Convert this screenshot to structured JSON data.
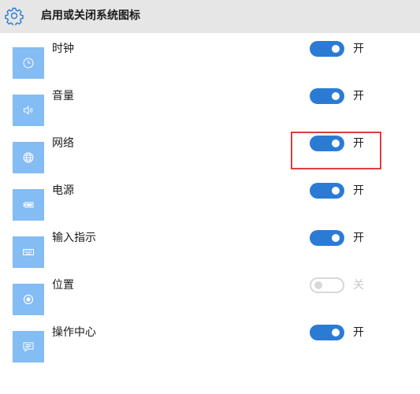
{
  "header": {
    "title": "启用或关闭系统图标",
    "icon": "gear-icon"
  },
  "items": [
    {
      "label": "时钟",
      "state": "开",
      "on": true,
      "icon": "clock-icon"
    },
    {
      "label": "音量",
      "state": "开",
      "on": true,
      "icon": "volume-icon"
    },
    {
      "label": "网络",
      "state": "开",
      "on": true,
      "icon": "globe-icon"
    },
    {
      "label": "电源",
      "state": "开",
      "on": true,
      "icon": "battery-icon"
    },
    {
      "label": "输入指示",
      "state": "开",
      "on": true,
      "icon": "keyboard-icon"
    },
    {
      "label": "位置",
      "state": "关",
      "on": false,
      "icon": "location-icon"
    },
    {
      "label": "操作中心",
      "state": "开",
      "on": true,
      "icon": "message-icon"
    }
  ],
  "colors": {
    "header_bg": "#e6e6e6",
    "tile_bg": "#84bcf4",
    "toggle_on": "#2b7bd4",
    "toggle_off_border": "#d8d8d8",
    "highlight": "#e03c3c"
  }
}
